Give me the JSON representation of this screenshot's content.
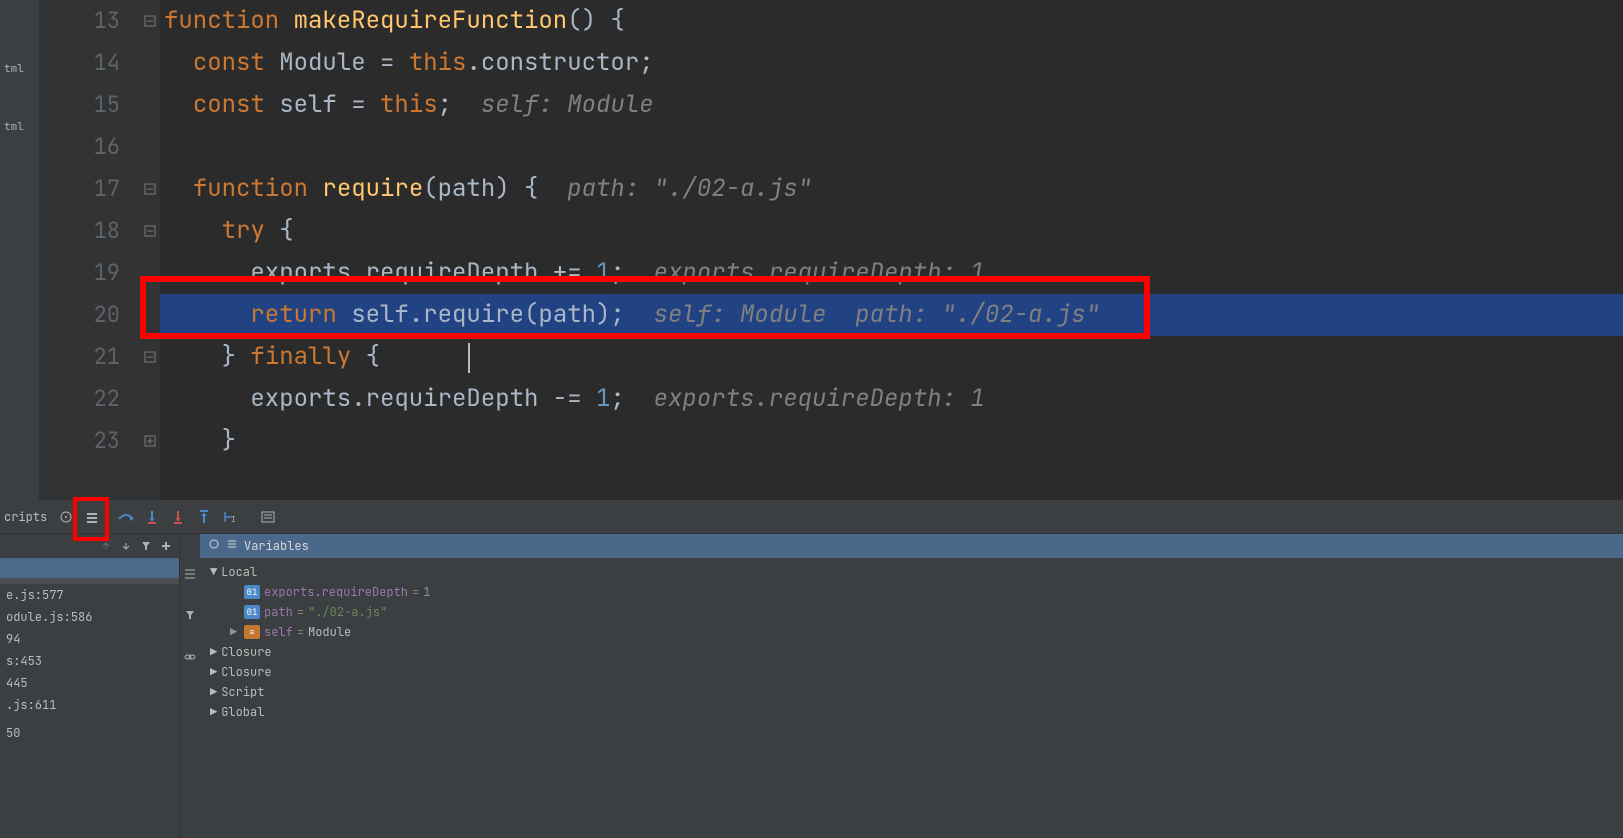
{
  "sidebar_files": [
    "tml",
    "tml"
  ],
  "editor": {
    "lines": [
      {
        "num": "13"
      },
      {
        "num": "14"
      },
      {
        "num": "15"
      },
      {
        "num": "16"
      },
      {
        "num": "17"
      },
      {
        "num": "18"
      },
      {
        "num": "19"
      },
      {
        "num": "20"
      },
      {
        "num": "21"
      },
      {
        "num": "22"
      },
      {
        "num": "23"
      }
    ],
    "code": {
      "l13": {
        "kw": "function ",
        "fn": "makeRequireFunction",
        "rest": "() {"
      },
      "l14": {
        "indent": "  ",
        "kw": "const ",
        "ident": "Module = ",
        "kw2": "this",
        "rest": ".constructor;"
      },
      "l15": {
        "indent": "  ",
        "kw": "const ",
        "ident": "self = ",
        "kw2": "this",
        "rest": ";",
        "hint": "  self: Module"
      },
      "l17": {
        "indent": "  ",
        "kw": "function ",
        "fn": "require",
        "params": "(path) {",
        "hint": "  path: \"./02-a.js\""
      },
      "l18": {
        "indent": "    ",
        "kw": "try ",
        "rest": "{"
      },
      "l19": {
        "indent": "      ",
        "ident": "exports.requireDepth += ",
        "num": "1",
        "rest": ";",
        "hint": "  exports.requireDepth: 1"
      },
      "l20": {
        "indent": "      ",
        "kw": "return ",
        "ident": "self.require(path)",
        "rest": ";",
        "hint": "  self: Module  path: \"./02-a.js\""
      },
      "l21": {
        "indent": "    ",
        "rest": "} ",
        "kw": "finally ",
        "rest2": "{"
      },
      "l22": {
        "indent": "      ",
        "ident": "exports.requireDepth -= ",
        "num": "1",
        "rest": ";",
        "hint": "  exports.requireDepth: 1"
      },
      "l23": {
        "indent": "    ",
        "rest": "}"
      }
    }
  },
  "debug": {
    "scripts_label": "cripts",
    "variables_title": "Variables",
    "frames": [
      "e.js:577",
      "odule.js:586",
      "94",
      "s:453",
      "445",
      ".js:611",
      "",
      "50"
    ],
    "scopes": {
      "local": "Local",
      "closure1": "Closure",
      "closure2": "Closure",
      "script": "Script",
      "global": "Global"
    },
    "vars": {
      "requireDepth": {
        "badge": "01",
        "name": "exports.requireDepth",
        "eq": " = ",
        "val": "1"
      },
      "path": {
        "badge": "01",
        "name": "path",
        "eq": " = ",
        "val": "\"./02-a.js\""
      },
      "self": {
        "name": "self",
        "eq": " = ",
        "val": "Module"
      }
    }
  }
}
